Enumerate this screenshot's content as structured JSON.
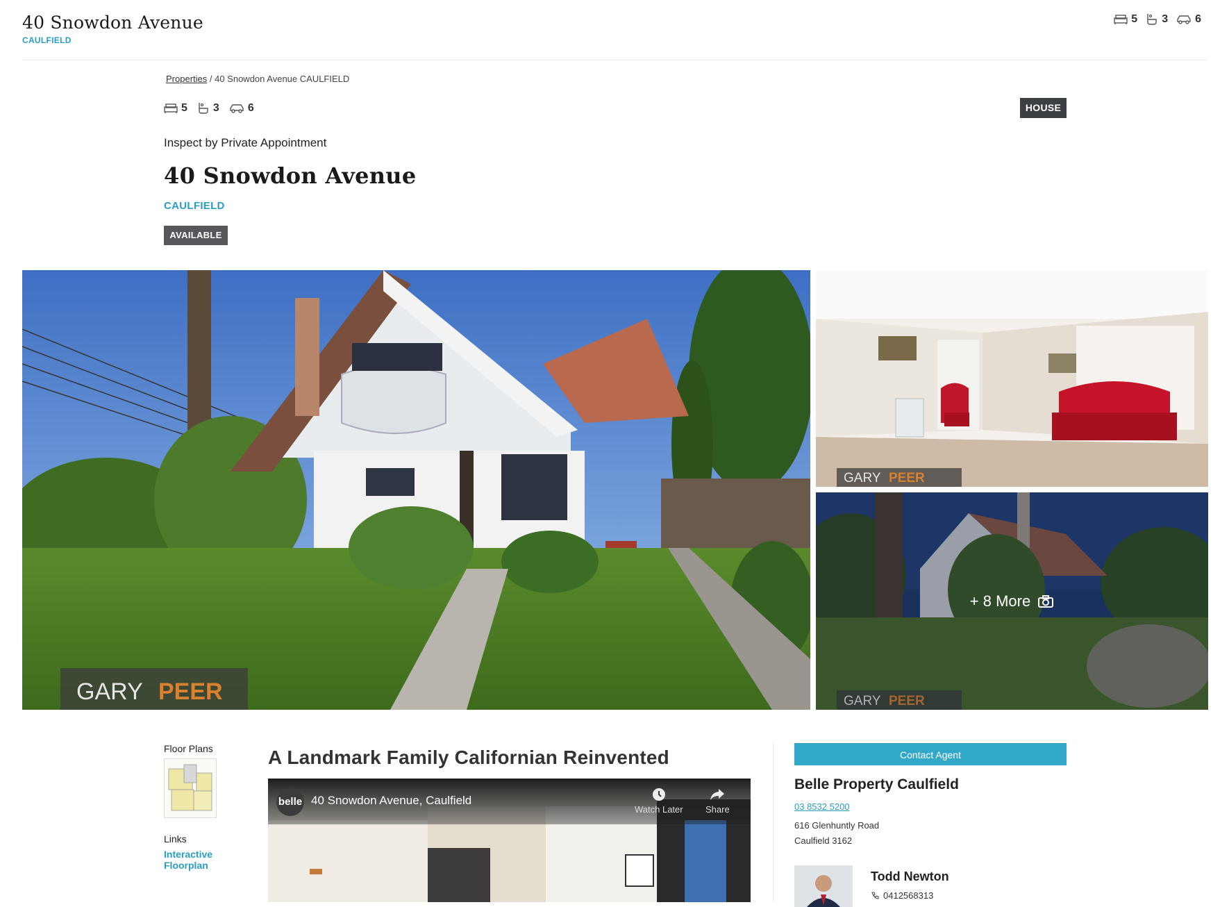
{
  "header": {
    "title": "40 Snowdon Avenue",
    "suburb": "CAULFIELD",
    "beds": "5",
    "baths": "3",
    "cars": "6"
  },
  "breadcrumb": {
    "link": "Properties",
    "current": "/ 40 Snowdon Avenue CAULFIELD"
  },
  "property": {
    "beds": "5",
    "baths": "3",
    "cars": "6",
    "type_badge": "HOUSE",
    "inspection": "Inspect by Private Appointment",
    "title": "40 Snowdon Avenue",
    "suburb": "CAULFIELD",
    "status_badge": "AVAILABLE"
  },
  "gallery": {
    "watermark_a": "GARY",
    "watermark_b": "PEER",
    "more_label": "+ 8 More"
  },
  "sidebar": {
    "floor_plans_label": "Floor Plans",
    "links_label": "Links",
    "link_interactive": "Interactive",
    "link_floorplan": "Floorplan"
  },
  "description": {
    "heading": "A Landmark Family Californian Reinvented"
  },
  "video": {
    "logo_text": "belle",
    "title": "40 Snowdon Avenue, Caulfield",
    "watch_later": "Watch Later",
    "share": "Share"
  },
  "agent_panel": {
    "contact_button": "Contact Agent",
    "agency_name": "Belle Property Caulfield",
    "agency_phone": "03 8532 5200",
    "address_line1": "616 Glenhuntly Road",
    "address_line2": "Caulfield 3162",
    "agent_name": "Todd Newton",
    "agent_phone": "0412568313"
  },
  "colors": {
    "accent": "#2a9ec1",
    "badge_dark": "#3c3f44",
    "contact_button": "#32a8c8",
    "watermark_peer": "#d9812e"
  }
}
